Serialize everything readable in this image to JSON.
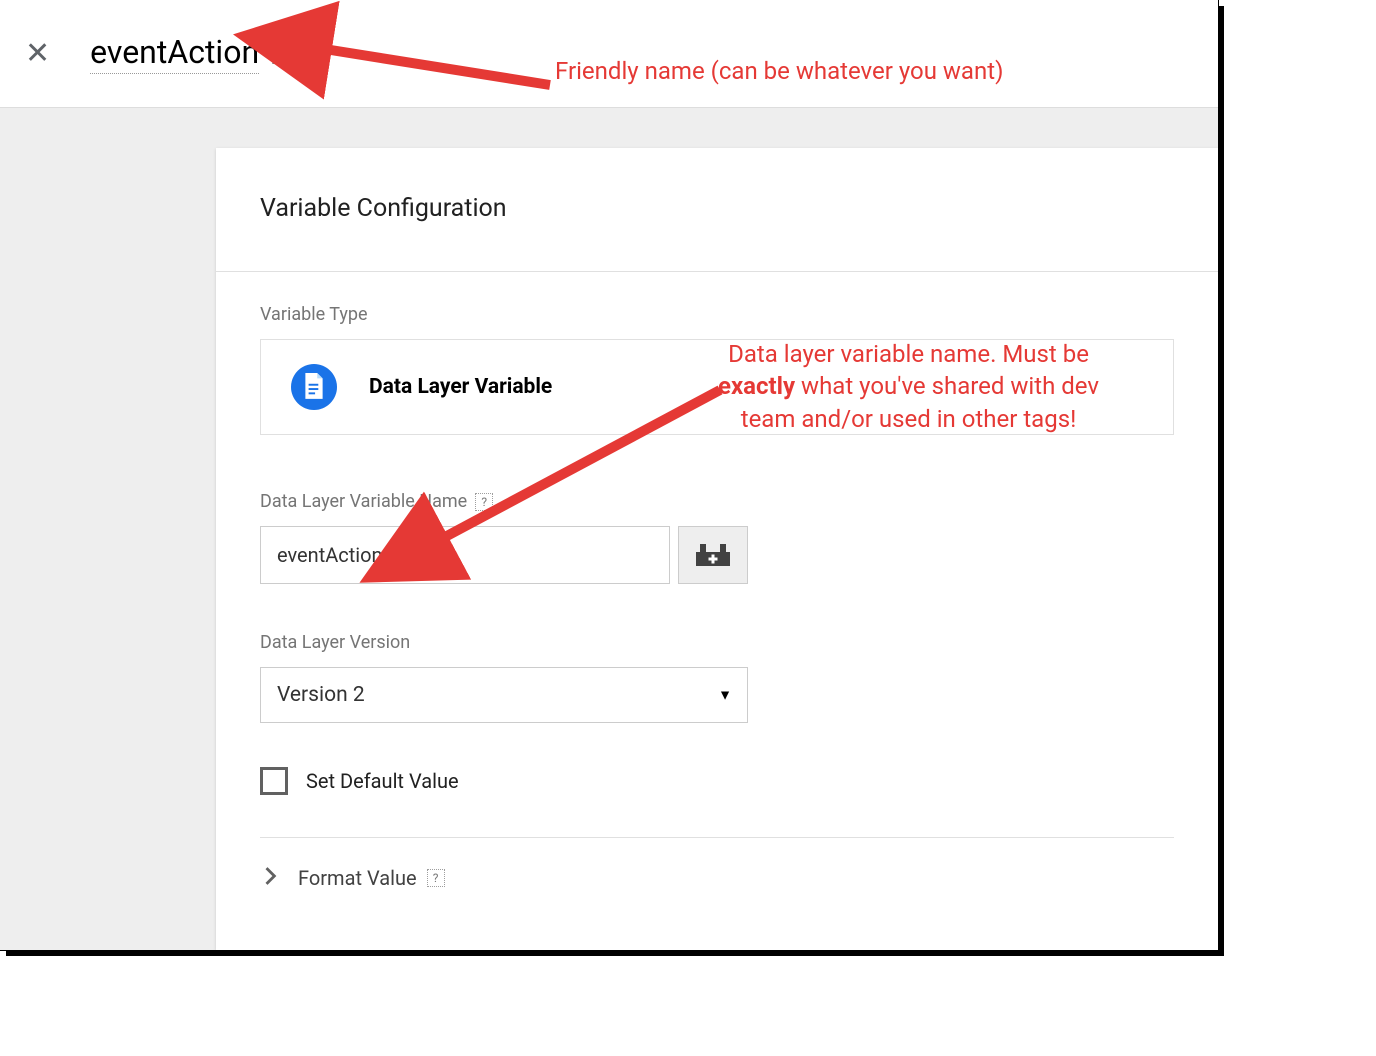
{
  "header": {
    "variable_name": "eventAction"
  },
  "panel": {
    "title": "Variable Configuration",
    "type_section_label": "Variable Type",
    "type_name": "Data Layer Variable",
    "dlv_name_label": "Data Layer Variable Name",
    "dlv_name_value": "eventAction",
    "version_label": "Data Layer Version",
    "version_value": "Version 2",
    "default_checkbox_label": "Set Default Value",
    "format_value_label": "Format Value"
  },
  "annotations": {
    "friendly_name": "Friendly name (can be whatever you want)",
    "dlv_line1": "Data layer variable name. Must be",
    "dlv_exactly": "exactly",
    "dlv_line2_rest": " what you've shared with dev",
    "dlv_line3": "team and/or used in other tags!"
  }
}
